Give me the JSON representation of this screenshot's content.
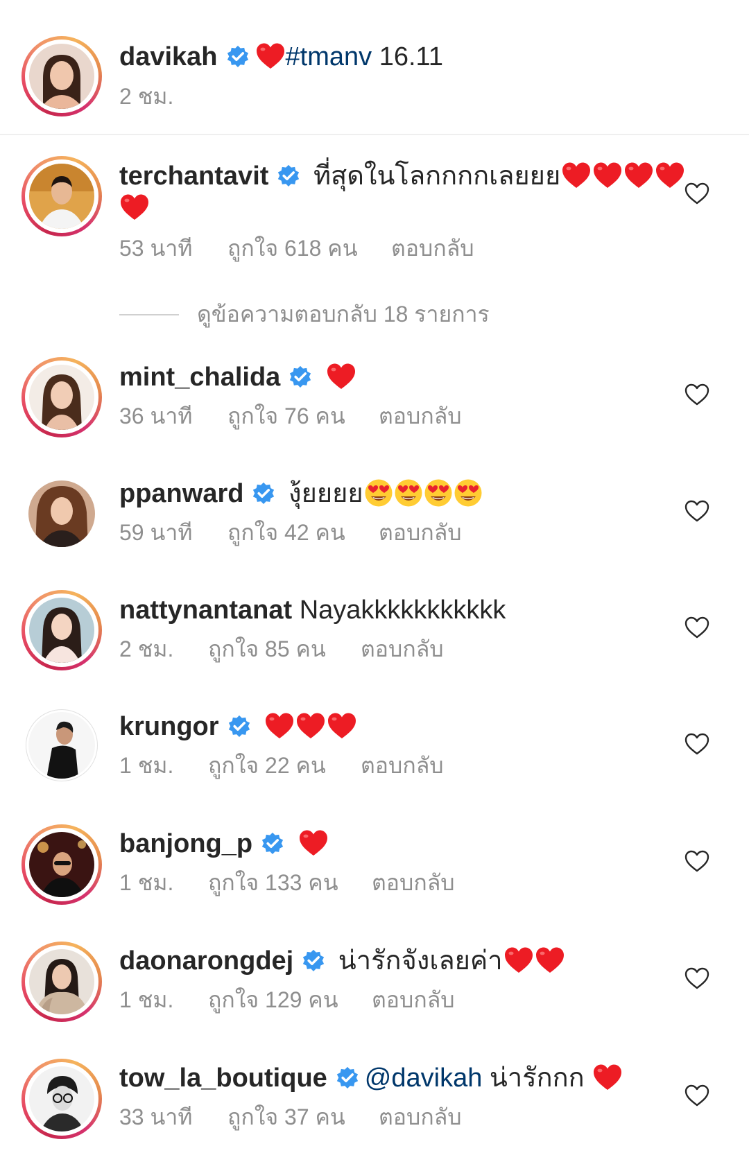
{
  "post": {
    "username": "davikah",
    "caption_tag": "#tmanv",
    "caption_text": " 16.11",
    "time": "2 ชม."
  },
  "colors": {
    "verified": "#3897f0",
    "heart": "#ed1c24",
    "tag": "#00376b",
    "meta": "#8e8e8e"
  },
  "icons": {
    "verified": "verified-badge-icon",
    "heart": "heart-emoji",
    "like": "heart-outline-icon",
    "love_eyes": "heart-eyes-emoji"
  },
  "comments": [
    {
      "username": "terchantavit",
      "text": " ที่สุดในโลกกกกเลยยย",
      "time": "53 นาที",
      "likes": "ถูกใจ 618 คน",
      "reply": "ตอบกลับ"
    },
    {
      "username": "mint_chalida",
      "text": " ",
      "time": "36 นาที",
      "likes": "ถูกใจ 76 คน",
      "reply": "ตอบกลับ"
    },
    {
      "username": "ppanward",
      "text": " งุ้ยยยย",
      "time": "59 นาที",
      "likes": "ถูกใจ 42 คน",
      "reply": "ตอบกลับ"
    },
    {
      "username": "nattynantanat",
      "text": " Nayakkkkkkkkkkk",
      "time": "2 ชม.",
      "likes": "ถูกใจ 85 คน",
      "reply": "ตอบกลับ"
    },
    {
      "username": "krungor",
      "text": " ",
      "time": "1 ชม.",
      "likes": "ถูกใจ 22 คน",
      "reply": "ตอบกลับ"
    },
    {
      "username": "banjong_p",
      "text": " ",
      "time": "1 ชม.",
      "likes": "ถูกใจ 133 คน",
      "reply": "ตอบกลับ"
    },
    {
      "username": "daonarongdej",
      "text": " น่ารักจังเลยค่า",
      "time": "1 ชม.",
      "likes": "ถูกใจ 129 คน",
      "reply": "ตอบกลับ"
    },
    {
      "username": "tow_la_boutique",
      "mention": "@davikah",
      "text": " น่ารักกก ",
      "time": "33 นาที",
      "likes": "ถูกใจ 37 คน",
      "reply": "ตอบกลับ"
    }
  ],
  "view_replies": "ดูข้อความตอบกลับ 18 รายการ"
}
